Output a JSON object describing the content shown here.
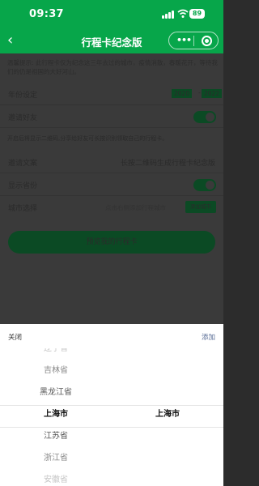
{
  "status_bar": {
    "time": "09:37",
    "battery": "89"
  },
  "nav": {
    "back_glyph": "‹",
    "title": "行程卡纪念版",
    "more_glyph": "•••"
  },
  "page": {
    "notice": "温馨提示: 此行程卡仅为纪念这三年去过的城市，疫情消散，春暖花开，等待我们的仍是祖国的大好河山。",
    "year": {
      "label": "年份设定",
      "start": "2020",
      "separator": "-",
      "end": "2022"
    },
    "invite": {
      "label": "邀请好友",
      "enabled": true
    },
    "invite_hint": "开启后将显示二维码,分享给好友可长按识别领取自己的行程卡。",
    "invite_text": {
      "label": "邀请文案",
      "value": "长按二维码生成行程卡纪念版"
    },
    "show_province": {
      "label": "显示省份",
      "enabled": true
    },
    "city_select": {
      "label": "城市选择",
      "placeholder": "点击右侧添加行程城市",
      "add_button": "添加城市"
    },
    "preview_button": "预览我的行程卡"
  },
  "picker": {
    "close_label": "关闭",
    "confirm_label": "添加",
    "provinces": [
      "辽宁省",
      "吉林省",
      "黑龙江省",
      "上海市",
      "江苏省",
      "浙江省",
      "安徽省"
    ],
    "selected_province": "上海市",
    "cities": [
      "上海市"
    ],
    "selected_city": "上海市"
  }
}
